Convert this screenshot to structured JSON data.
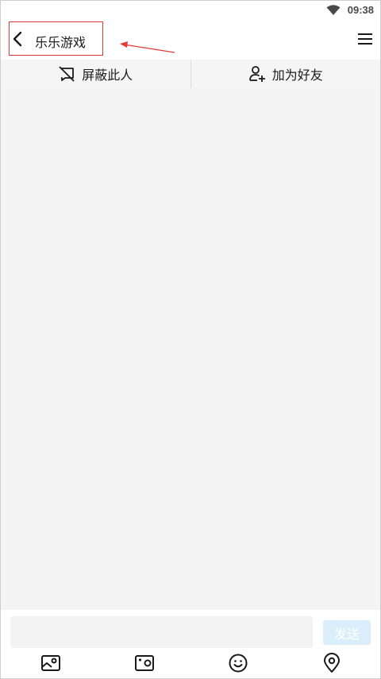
{
  "status_bar": {
    "time": "09:38",
    "wifi_icon": "wifi-icon"
  },
  "header": {
    "back_icon": "chevron-left-icon",
    "title": "乐乐游戏",
    "menu_icon": "menu-icon"
  },
  "annotation": {
    "box_color": "#e53935",
    "arrow_color": "#e53935"
  },
  "action_bar": {
    "block": {
      "icon": "block-message-icon",
      "label": "屏蔽此人"
    },
    "add_friend": {
      "icon": "add-user-icon",
      "label": "加为好友"
    }
  },
  "input_panel": {
    "message_value": "",
    "send_label": "发送",
    "send_color": "#d9edfb"
  },
  "toolbar": {
    "items": [
      {
        "icon": "image-icon"
      },
      {
        "icon": "camera-icon"
      },
      {
        "icon": "emoji-icon"
      },
      {
        "icon": "location-icon"
      }
    ]
  }
}
